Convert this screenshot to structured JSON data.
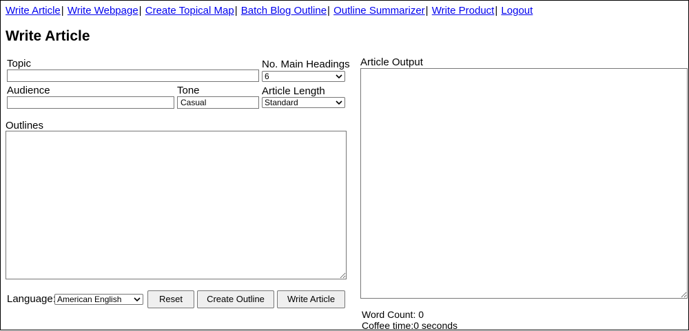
{
  "nav": {
    "items": [
      {
        "label": "Write Article"
      },
      {
        "label": "Write Webpage"
      },
      {
        "label": "Create Topical Map"
      },
      {
        "label": "Batch Blog Outline"
      },
      {
        "label": "Outline Summarizer"
      },
      {
        "label": "Write Product"
      },
      {
        "label": "Logout"
      }
    ],
    "separator": "|"
  },
  "page": {
    "title": "Write Article"
  },
  "form": {
    "topic": {
      "label": "Topic",
      "value": ""
    },
    "main_headings": {
      "label": "No. Main Headings",
      "selected": "6"
    },
    "audience": {
      "label": "Audience",
      "value": ""
    },
    "tone": {
      "label": "Tone",
      "value": "Casual"
    },
    "article_length": {
      "label": "Article Length",
      "selected": "Standard"
    },
    "outlines": {
      "label": "Outlines",
      "value": ""
    },
    "language": {
      "label": "Language:",
      "selected": "American English"
    },
    "buttons": {
      "reset": "Reset",
      "create_outline": "Create Outline",
      "write_article": "Write Article"
    }
  },
  "output": {
    "label": "Article Output",
    "value": "",
    "word_count": "Word Count: 0",
    "coffee_time": "Coffee time:0 seconds"
  },
  "icons": {
    "select_arrow": "chevron-down-icon"
  }
}
